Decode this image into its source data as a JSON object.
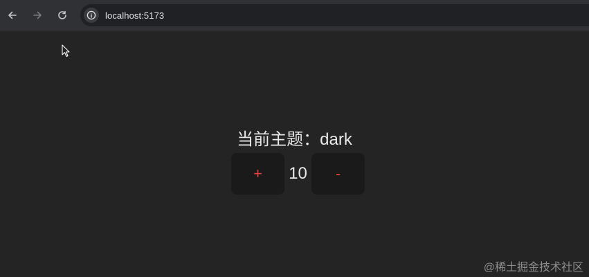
{
  "browser": {
    "url": "localhost:5173",
    "icons": {
      "back": "arrow-left-icon",
      "forward": "arrow-right-icon",
      "reload": "reload-icon",
      "site_info": "info-icon"
    }
  },
  "app": {
    "theme_label": "当前主题：dark",
    "increment_label": "+",
    "count": "10",
    "decrement_label": "-"
  },
  "watermark": "@稀土掘金技术社区",
  "colors": {
    "page_background": "#242424",
    "button_background": "#1a1a1a",
    "button_text": "#e0433a",
    "text": "#e8e8e8"
  }
}
